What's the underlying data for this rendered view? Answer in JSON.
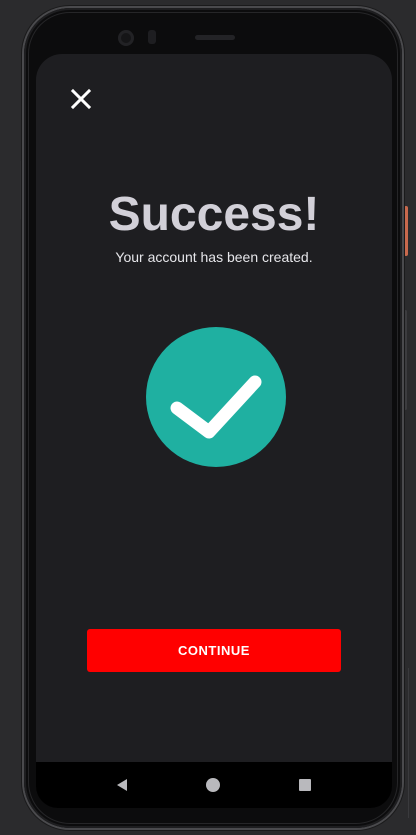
{
  "screen": {
    "title": "Success!",
    "subtitle": "Your account has been created.",
    "continue_label": "CONTINUE"
  },
  "icons": {
    "close": "close-icon",
    "check": "checkmark-icon",
    "nav_back": "back-triangle-icon",
    "nav_home": "home-circle-icon",
    "nav_recents": "recents-square-icon"
  },
  "colors": {
    "background": "#1e1e21",
    "title": "#d2d0d8",
    "accent_teal": "#1fb0a1",
    "button_red": "#ff0000",
    "button_text": "#ffffff"
  }
}
